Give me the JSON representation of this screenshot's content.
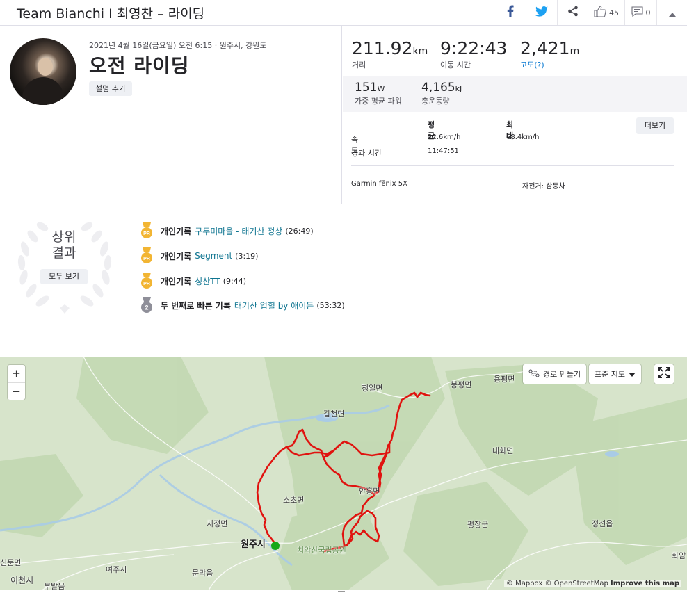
{
  "header": {
    "title": "Team Bianchi I 최영찬 – 라이딩",
    "kudos_count": "45",
    "comments_count": "0"
  },
  "activity": {
    "meta": "2021년 4월 16일(금요일) 오전 6:15 · 원주시, 강원도",
    "title": "오전 라이딩",
    "add_description_label": "설명 추가"
  },
  "stats": {
    "distance": {
      "value": "211.92",
      "unit": "km",
      "label": "거리"
    },
    "moving_time": {
      "value": "9:22:43",
      "label": "이동 시간"
    },
    "elevation": {
      "value": "2,421",
      "unit": "m",
      "label": "고도(?)"
    },
    "weighted_power": {
      "value": "151",
      "unit": "W",
      "label": "가중 평균 파워"
    },
    "total_work": {
      "value": "4,165",
      "unit": "kJ",
      "label": "총운동량"
    },
    "table": {
      "col_avg": "평균",
      "col_max": "최대",
      "speed_label": "속도",
      "speed_avg": "22.6km/h",
      "speed_max": "68.4km/h",
      "elapsed_label": "경과 시간",
      "elapsed_value": "11:47:51"
    },
    "more_label": "더보기",
    "device": "Garmin fēnix 5X",
    "bike": "자전거: 삼둥차"
  },
  "achievements": {
    "title_line1": "상위",
    "title_line2": "결과",
    "view_all_label": "모두 보기",
    "items": [
      {
        "kind": "개인기록",
        "segment": "구두미마을 - 태기산 정상",
        "time": "(26:49)",
        "medal": "pr"
      },
      {
        "kind": "개인기록",
        "segment": "Segment",
        "time": "(3:19)",
        "medal": "pr"
      },
      {
        "kind": "개인기록",
        "segment": "성산TT",
        "time": "(9:44)",
        "medal": "pr"
      },
      {
        "kind": "두 번째로 빠른 기록",
        "segment": "태기산 업힐 by 애이든",
        "time": "(53:32)",
        "medal": "2"
      }
    ],
    "pr_medal_text": "PR",
    "second_medal_text": "2"
  },
  "map": {
    "zoom_in": "+",
    "zoom_out": "−",
    "route_builder_label": "경로 만들기",
    "map_type_label": "표준 지도",
    "attribution_mapbox": "© Mapbox",
    "attribution_osm": "© OpenStreetMap",
    "attribution_improve": "Improve this map",
    "places": {
      "cheongil": "청일면",
      "bongpyeong": "봉평면",
      "yongpyeong": "용평면",
      "gapcheon": "갑천면",
      "daehwa": "대화면",
      "anheung": "안흥면",
      "socho": "소초면",
      "jijeong": "지정면",
      "pyeongchang": "평창군",
      "jeongseon": "정선읍",
      "wonju": "원주시",
      "chiaksan": "치악산국립공원",
      "sinun": "신둔면",
      "yeoju": "여주시",
      "munmak": "문막읍",
      "icheon": "이천시",
      "bubal": "부발읍",
      "hwaam": "화암"
    },
    "colors": {
      "route": "#e0130f",
      "start": "#16a818",
      "map_base": "#d7e4cb",
      "forest": "#c3d8b2",
      "river": "#a9cbe6"
    }
  }
}
